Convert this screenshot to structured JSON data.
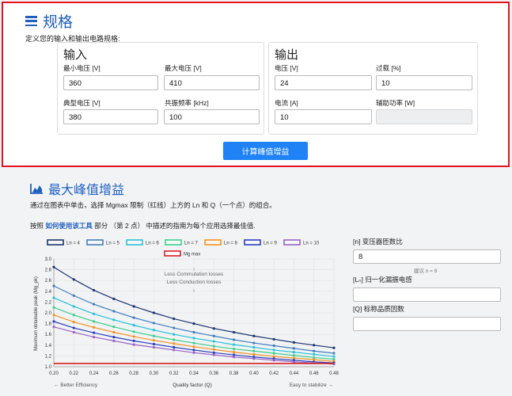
{
  "spec": {
    "title": "规格",
    "description": "定义您的输入和输出电路规格:",
    "input": {
      "title": "输入",
      "vmin_label": "最小电压 [V]",
      "vmin_value": "360",
      "vmax_label": "最大电压 [V]",
      "vmax_value": "410",
      "vtyp_label": "典型电压 [V]",
      "vtyp_value": "380",
      "freq_label": "共振频率 [kHz]",
      "freq_value": "100"
    },
    "output": {
      "title": "输出",
      "voltage_label": "电压 [V]",
      "voltage_value": "24",
      "overload_label": "过载 [%]",
      "overload_value": "10",
      "current_label": "电流 [A]",
      "current_value": "10",
      "aux_label": "辅助功率 [W]",
      "aux_value": ""
    },
    "calc_button": "计算峰值增益"
  },
  "peak": {
    "title": "最大峰值增益",
    "desc1": "通过在图表中单击，选择 Mgmax 限制（红线）上方的 Ln 和 Q（一个点）的组合。",
    "desc2_pre": "按照 ",
    "desc2_link": "如何使用该工具",
    "desc2_post": " 部分 （第 2 点） 中描述的指南为每个应用选择最佳值."
  },
  "side": {
    "n_label": "[n] 变压器匝数比",
    "n_value": "8",
    "n_hint": "建议 n = 8",
    "ln_label": "[Lₙ] 归一化漏振电感",
    "ln_value": "",
    "q_label": "[Q] 标称品质因数",
    "q_value": ""
  },
  "chart_data": {
    "type": "line",
    "xlabel": "Quality factor (Q)",
    "ylabel": "Maximum obtainable peak (Mg_pk)",
    "xlim": [
      0.2,
      0.48
    ],
    "ylim": [
      1.0,
      3.0
    ],
    "x_ticks": [
      "0.20",
      "0.22",
      "0.24",
      "0.26",
      "0.28",
      "0.30",
      "0.32",
      "0.34",
      "0.36",
      "0.38",
      "0.40",
      "0.42",
      "0.44",
      "0.46",
      "0.48"
    ],
    "y_ticks": [
      "1.0",
      "1.2",
      "1.4",
      "1.6",
      "1.8",
      "2.0",
      "2.2",
      "2.4",
      "2.6",
      "2.8",
      "3.0"
    ],
    "x": [
      0.2,
      0.22,
      0.24,
      0.26,
      0.28,
      0.3,
      0.32,
      0.34,
      0.36,
      0.38,
      0.4,
      0.42,
      0.44,
      0.46,
      0.48
    ],
    "series": [
      {
        "name": "Ln = 4",
        "color": "#1a3570",
        "values": [
          2.85,
          2.62,
          2.42,
          2.26,
          2.12,
          2.0,
          1.89,
          1.8,
          1.71,
          1.64,
          1.57,
          1.51,
          1.45,
          1.4,
          1.35
        ]
      },
      {
        "name": "Ln = 5",
        "color": "#3f7fbe",
        "values": [
          2.5,
          2.32,
          2.16,
          2.03,
          1.91,
          1.81,
          1.72,
          1.64,
          1.57,
          1.5,
          1.44,
          1.39,
          1.34,
          1.29,
          1.25
        ]
      },
      {
        "name": "Ln = 6",
        "color": "#27c2d8",
        "values": [
          2.28,
          2.12,
          1.98,
          1.87,
          1.77,
          1.68,
          1.6,
          1.53,
          1.47,
          1.41,
          1.36,
          1.31,
          1.27,
          1.23,
          1.19
        ]
      },
      {
        "name": "Ln = 7",
        "color": "#3ccf8e",
        "values": [
          2.1,
          1.96,
          1.84,
          1.74,
          1.65,
          1.57,
          1.5,
          1.44,
          1.38,
          1.33,
          1.29,
          1.25,
          1.21,
          1.17,
          1.14
        ]
      },
      {
        "name": "Ln = 8",
        "color": "#f39321",
        "values": [
          1.96,
          1.83,
          1.73,
          1.64,
          1.56,
          1.49,
          1.43,
          1.37,
          1.32,
          1.27,
          1.23,
          1.19,
          1.16,
          1.13,
          1.1
        ]
      },
      {
        "name": "Ln = 9",
        "color": "#2a3fbf",
        "values": [
          1.84,
          1.72,
          1.63,
          1.55,
          1.48,
          1.42,
          1.36,
          1.31,
          1.26,
          1.22,
          1.18,
          1.15,
          1.12,
          1.09,
          1.07
        ]
      },
      {
        "name": "Ln = 10",
        "color": "#9a62c4",
        "values": [
          1.74,
          1.64,
          1.55,
          1.48,
          1.41,
          1.36,
          1.31,
          1.26,
          1.22,
          1.18,
          1.15,
          1.12,
          1.09,
          1.07,
          1.05
        ]
      },
      {
        "name": "Mg max",
        "color": "#d62020",
        "values": [
          1.06,
          1.06,
          1.06,
          1.06,
          1.06,
          1.06,
          1.06,
          1.06,
          1.06,
          1.06,
          1.06,
          1.06,
          1.06,
          1.06,
          1.06
        ]
      }
    ],
    "annotations": {
      "losses1": "Less Commutation losses",
      "losses2": "Less Conduction losses",
      "left_note": "← Better Efficiency",
      "right_note": "Easy to stabilize →"
    }
  }
}
